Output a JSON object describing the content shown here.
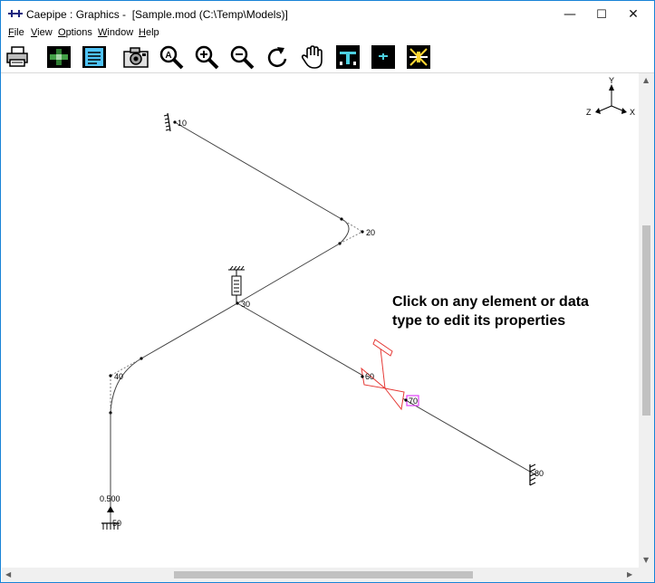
{
  "window": {
    "title": "Caepipe : Graphics -  [Sample.mod (C:\\Temp\\Models)]",
    "minimize": "—",
    "maximize": "☐",
    "close": "✕"
  },
  "menu": [
    "File",
    "View",
    "Options",
    "Window",
    "Help"
  ],
  "toolbar": {
    "buttons": [
      "print-icon",
      "render-icon",
      "list-icon",
      "camera-icon",
      "zoom-auto-icon",
      "zoom-in-icon",
      "zoom-out-icon",
      "rotate-icon",
      "pan-hand-icon",
      "section-icon",
      "small-section-icon",
      "support-toggle-icon"
    ]
  },
  "canvas": {
    "hint": "Click on any element or data type to edit its properties",
    "nodes": [
      "10",
      "20",
      "30",
      "40",
      "50",
      "60",
      "70",
      "80"
    ],
    "dimension_label": "0.500",
    "axes": {
      "y": "Y",
      "z": "Z",
      "x": "X"
    },
    "colors": {
      "pipe": "#404040",
      "valve": "#e53935",
      "highlight": "#e040fb"
    }
  }
}
